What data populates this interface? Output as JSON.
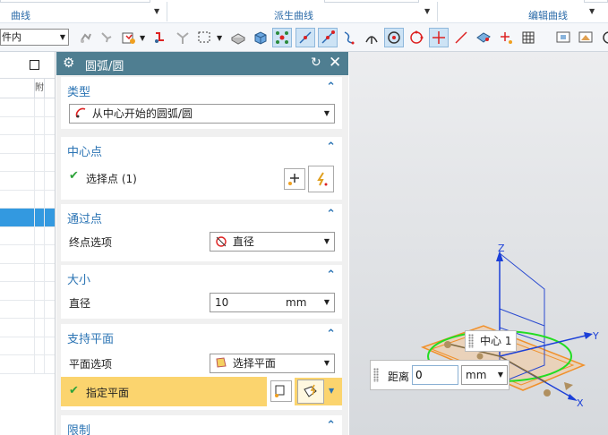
{
  "ribbon": {
    "groups": [
      {
        "label": "曲线"
      },
      {
        "label": "派生曲线"
      },
      {
        "label": "编辑曲线"
      }
    ]
  },
  "toolbar": {
    "filter_value": "件内",
    "icons": [
      "snap-lock-icon",
      "snap-pin-icon",
      "filter-frame-icon",
      "rotate-point-icon",
      "snap-vertex-icon",
      "box-select-icon",
      "solid-body-icon",
      "cube-icon",
      "end-point-icon",
      "mid-point-icon",
      "control-point-icon",
      "tangent-curve-icon",
      "perpendicular-icon",
      "arc-center-icon",
      "quadrant-point-icon",
      "intersection-point-icon",
      "existing-point-icon",
      "face-point-icon",
      "point-on-curve-icon",
      "grid-icon",
      "view-fit-icon",
      "render-style-icon",
      "orient-icon"
    ]
  },
  "navigator": {
    "column_header": "附",
    "rows": 15,
    "selected_row": 6
  },
  "dialog": {
    "title": "圆弧/圆",
    "reset_icon": "reset-icon",
    "close_icon": "close-icon",
    "type": {
      "title": "类型",
      "value": "从中心开始的圆弧/圆"
    },
    "center": {
      "title": "中心点",
      "select_label": "选择点 (1)"
    },
    "through": {
      "title": "通过点",
      "end_option_label": "终点选项",
      "end_option_value": "直径"
    },
    "size": {
      "title": "大小",
      "diameter_label": "直径",
      "diameter_value": "10",
      "diameter_unit": "mm"
    },
    "support_plane": {
      "title": "支持平面",
      "plane_option_label": "平面选项",
      "plane_option_value": "选择平面",
      "specify_label": "指定平面"
    },
    "limits": {
      "title": "限制"
    }
  },
  "viewport": {
    "center_label": "中心 1",
    "distance_label": "距离",
    "distance_value": "0",
    "distance_unit": "mm",
    "axis_labels": {
      "x": "X",
      "y": "Y",
      "z": "Z"
    }
  },
  "colors": {
    "dialog_title_bg": "#4f7e91",
    "group_title": "#2b74b4",
    "highlight": "#fbd46e",
    "selection": "#3399e0"
  }
}
